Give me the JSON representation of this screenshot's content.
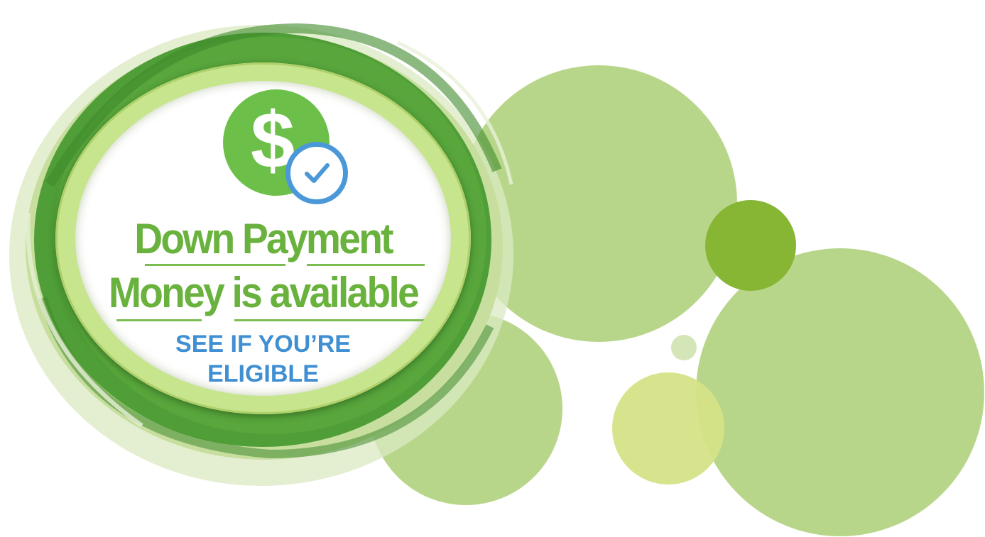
{
  "headline": {
    "line1": "Down Payment",
    "line2": "Money is available"
  },
  "cta": {
    "line1": "SEE IF YOU’RE",
    "line2": "ELIGIBLE"
  },
  "icons": {
    "badge": "dollar-sign-icon",
    "check": "checkmark-icon"
  },
  "colors": {
    "brand_green": "#6ab23e",
    "dark_green": "#4d9a32",
    "light_green": "#b8d68a",
    "check_blue": "#4a98d8",
    "cta_blue": "#3f8fd2"
  }
}
